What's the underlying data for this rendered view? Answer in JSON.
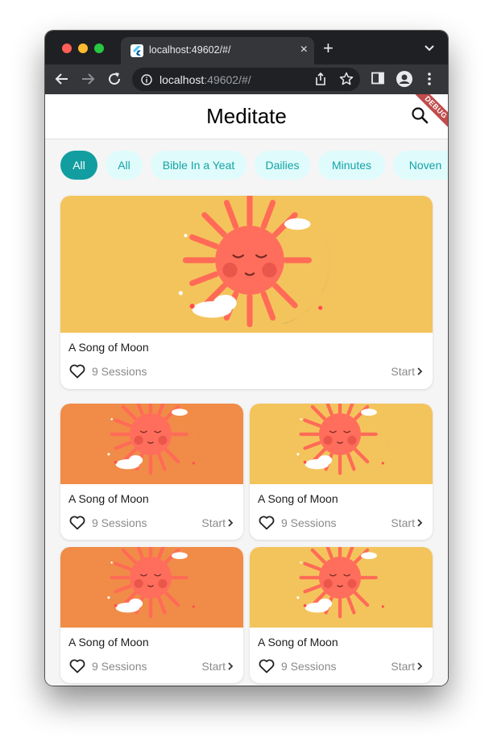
{
  "browser": {
    "tab_title": "localhost:49602/#/",
    "tab_close": "×",
    "new_tab": "+",
    "url_host": "localhost",
    "url_rest": ":49602/#/"
  },
  "app": {
    "title": "Meditate",
    "debug_label": "DEBUG",
    "accent_color": "#129ea1",
    "chip_bg_color": "#e0fbfb",
    "categories": [
      "All",
      "All",
      "Bible In a Yeat",
      "Dailies",
      "Minutes",
      "Noven"
    ]
  },
  "featured": {
    "title": "A Song of Moon",
    "sessions": "9 Sessions",
    "start": "Start",
    "bg_color": "#f3c45c"
  },
  "grid": [
    {
      "title": "A Song of Moon",
      "sessions": "9 Sessions",
      "start": "Start",
      "bg_color": "#f08c47"
    },
    {
      "title": "A Song of Moon",
      "sessions": "9 Sessions",
      "start": "Start",
      "bg_color": "#f3c45c"
    },
    {
      "title": "A Song of Moon",
      "sessions": "9 Sessions",
      "start": "Start",
      "bg_color": "#f08c47"
    },
    {
      "title": "A Song of Moon",
      "sessions": "9 Sessions",
      "start": "Start",
      "bg_color": "#f3c45c"
    }
  ]
}
